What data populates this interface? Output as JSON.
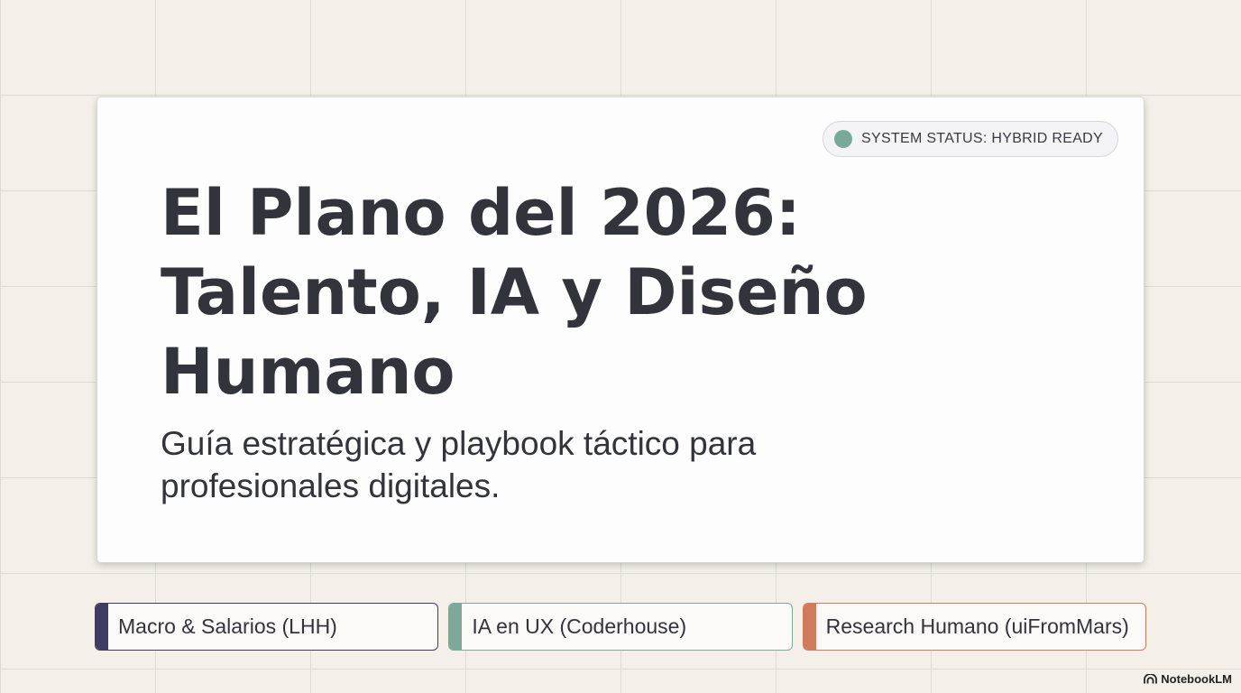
{
  "colors": {
    "status_dot": "#79a998",
    "tag_macro": "#3e3c64",
    "tag_ia": "#7ea899",
    "tag_research": "#d07a5e"
  },
  "card": {
    "status": "SYSTEM STATUS: HYBRID READY",
    "title_line1": "El Plano del 2026:",
    "title_line2": "Talento, IA y Diseño",
    "title_line3": "Humano",
    "subtitle_line1": "Guía estratégica y playbook táctico para",
    "subtitle_line2": "profesionales digitales."
  },
  "tags": [
    {
      "label": "Macro & Salarios (LHH)"
    },
    {
      "label": "IA en UX (Coderhouse)"
    },
    {
      "label": "Research Humano (uiFromMars)"
    }
  ],
  "brand": {
    "icon": "notebooklm-icon",
    "label": "NotebookLM"
  }
}
